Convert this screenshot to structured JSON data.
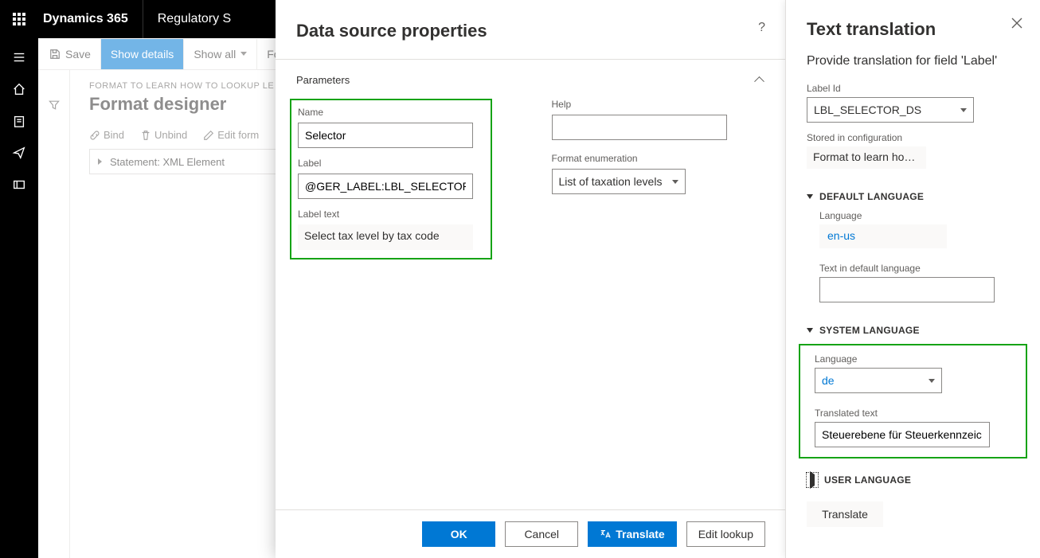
{
  "topbar": {
    "app": "Dynamics 365",
    "page_segment": "Regulatory S"
  },
  "cmdbar": {
    "save": "Save",
    "show_details": "Show details",
    "show_all": "Show all",
    "fo": "Fo"
  },
  "main": {
    "breadcrumb": "FORMAT TO LEARN HOW TO LOOKUP LE D",
    "title": "Format designer",
    "toolbar": {
      "bind": "Bind",
      "unbind": "Unbind",
      "edit_formula": "Edit form"
    },
    "tree_item": "Statement: XML Element"
  },
  "center_panel": {
    "title": "Data source properties",
    "section": "Parameters",
    "name_lbl": "Name",
    "name_val": "Selector",
    "label_lbl": "Label",
    "label_val": "@GER_LABEL:LBL_SELECTOR_DS",
    "label_text_lbl": "Label text",
    "label_text_val": "Select tax level by tax code",
    "help_lbl": "Help",
    "help_val": "",
    "fmt_enum_lbl": "Format enumeration",
    "fmt_enum_val": "List of taxation levels",
    "buttons": {
      "ok": "OK",
      "cancel": "Cancel",
      "translate": "Translate",
      "edit_lookup": "Edit lookup"
    }
  },
  "right_panel": {
    "title": "Text translation",
    "subtitle": "Provide translation for field 'Label'",
    "label_id_lbl": "Label Id",
    "label_id_val": "LBL_SELECTOR_DS",
    "stored_lbl": "Stored in configuration",
    "stored_val": "Format to learn how t...",
    "default_lang_head": "DEFAULT LANGUAGE",
    "def_lang_lbl": "Language",
    "def_lang_val": "en-us",
    "def_text_lbl": "Text in default language",
    "def_text_val": "",
    "sys_lang_head": "SYSTEM LANGUAGE",
    "sys_lang_lbl": "Language",
    "sys_lang_val": "de",
    "sys_text_lbl": "Translated text",
    "sys_text_val": "Steuerebene für Steuerkennzeic...",
    "user_lang_head": "USER LANGUAGE",
    "translate_btn": "Translate"
  }
}
